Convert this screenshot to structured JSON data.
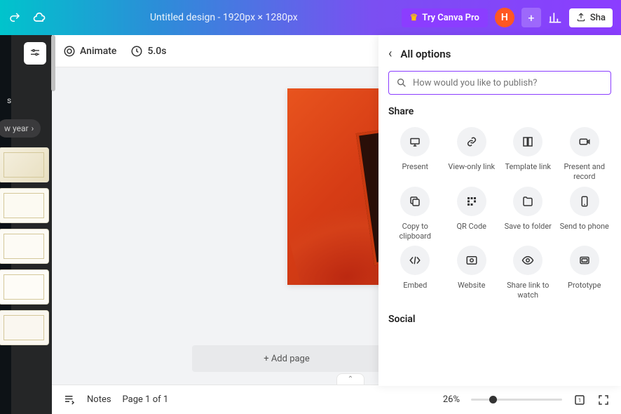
{
  "header": {
    "title": "Untitled design - 1920px × 1280px",
    "pro_label": "Try Canva Pro",
    "avatar_letter": "H",
    "share_label": "Sha"
  },
  "toolbar": {
    "animate_label": "Animate",
    "duration_label": "5.0s"
  },
  "sidebar": {
    "tab_suffix": "s",
    "pill_label": "w year"
  },
  "canvas": {
    "add_page_label": "+ Add page"
  },
  "footer": {
    "notes_label": "Notes",
    "page_label": "Page 1 of 1",
    "zoom_label": "26%"
  },
  "panel": {
    "title": "All options",
    "search_placeholder": "How would you like to publish?",
    "share_label": "Share",
    "social_label": "Social",
    "items_share": [
      {
        "label": "Present"
      },
      {
        "label": "View-only link"
      },
      {
        "label": "Template link"
      },
      {
        "label": "Present and record"
      },
      {
        "label": "Copy to clipboard"
      },
      {
        "label": "QR Code"
      },
      {
        "label": "Save to folder"
      },
      {
        "label": "Send to phone"
      },
      {
        "label": "Embed"
      },
      {
        "label": "Website"
      },
      {
        "label": "Share link to watch"
      },
      {
        "label": "Prototype"
      }
    ]
  }
}
